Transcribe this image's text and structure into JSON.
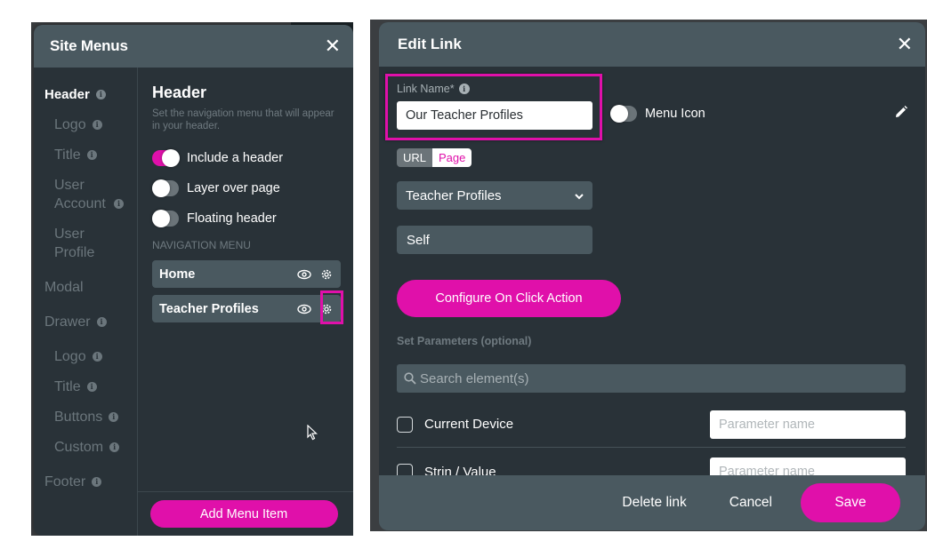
{
  "site_menus": {
    "title": "Site Menus",
    "sidebar": {
      "items": [
        {
          "label": "Header",
          "info": true,
          "active": true
        },
        {
          "label": "Logo",
          "info": true
        },
        {
          "label": "Title",
          "info": true
        },
        {
          "label": "User Account",
          "info": true
        },
        {
          "label": "User Profile",
          "info": false
        },
        {
          "label": "Modal",
          "info": false
        },
        {
          "label": "Drawer",
          "info": true
        },
        {
          "label": "Logo",
          "info": true
        },
        {
          "label": "Title",
          "info": true
        },
        {
          "label": "Buttons",
          "info": true
        },
        {
          "label": "Custom",
          "info": true
        },
        {
          "label": "Footer",
          "info": true
        }
      ]
    },
    "main": {
      "heading": "Header",
      "description": "Set the navigation menu that will appear in your header.",
      "toggles": [
        {
          "label": "Include a header",
          "on": true
        },
        {
          "label": "Layer over page",
          "on": false
        },
        {
          "label": "Floating header",
          "on": false
        }
      ],
      "nav_menu_label": "NAVIGATION MENU",
      "nav_items": [
        {
          "label": "Home"
        },
        {
          "label": "Teacher Profiles",
          "highlighted_gear": true
        }
      ],
      "add_button": "Add Menu Item"
    }
  },
  "edit_link": {
    "title": "Edit Link",
    "link_name_label": "Link Name*",
    "link_name_value": "Our Teacher Profiles",
    "menu_icon_label": "Menu Icon",
    "menu_icon_on": false,
    "link_type": {
      "options": [
        "URL",
        "Page"
      ],
      "selected": "Page"
    },
    "page_select_value": "Teacher Profiles",
    "target_value": "Self",
    "configure_button": "Configure On Click Action",
    "params_label": "Set Parameters (optional)",
    "search_placeholder": "Search element(s)",
    "params": [
      {
        "label": "Current Device",
        "placeholder": "Parameter name"
      },
      {
        "label": "Strin / Value",
        "placeholder": "Parameter name"
      }
    ],
    "footer": {
      "delete": "Delete link",
      "cancel": "Cancel",
      "save": "Save"
    }
  },
  "colors": {
    "accent": "#e010aa",
    "header_bg": "#4a5960",
    "panel_bg": "#293238"
  }
}
